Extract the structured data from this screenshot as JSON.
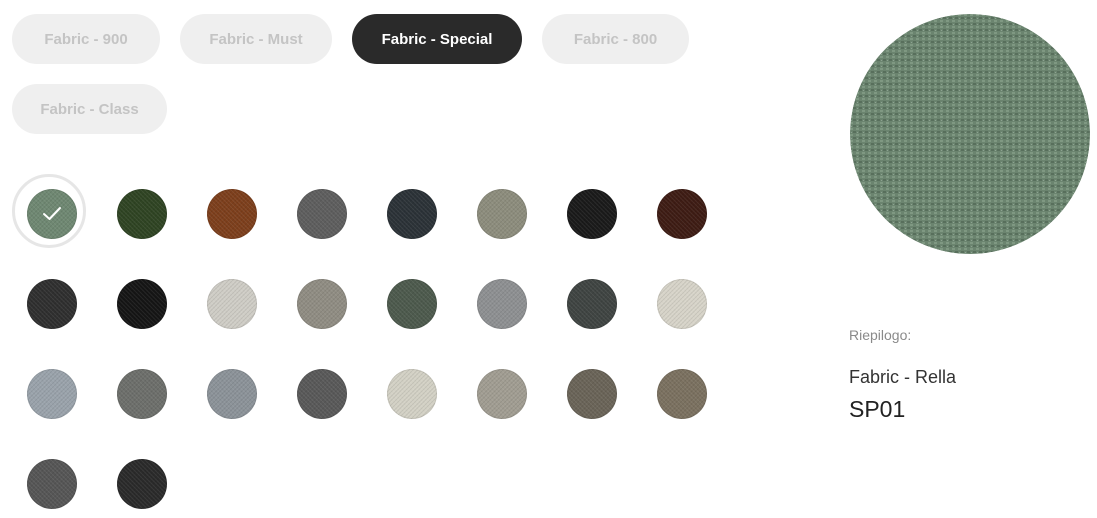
{
  "tabs": [
    {
      "label": "Fabric - 900",
      "active": false
    },
    {
      "label": "Fabric - Must",
      "active": false
    },
    {
      "label": "Fabric - Special",
      "active": true
    },
    {
      "label": "Fabric - 800",
      "active": false
    },
    {
      "label": "Fabric - Class",
      "active": false
    }
  ],
  "swatches": [
    {
      "color": "#6f8872",
      "selected": true
    },
    {
      "color": "#2f4423",
      "selected": false
    },
    {
      "color": "#7d3f1c",
      "selected": false
    },
    {
      "color": "#5e5e5e",
      "selected": false
    },
    {
      "color": "#2b3237",
      "selected": false
    },
    {
      "color": "#8d8d7d",
      "selected": false
    },
    {
      "color": "#1a1a1a",
      "selected": false
    },
    {
      "color": "#3e1c14",
      "selected": false
    },
    {
      "color": "#2f2f2f",
      "selected": false
    },
    {
      "color": "#151515",
      "selected": false
    },
    {
      "color": "#cfcdc6",
      "selected": false
    },
    {
      "color": "#908d83",
      "selected": false
    },
    {
      "color": "#4d5a4d",
      "selected": false
    },
    {
      "color": "#8e9092",
      "selected": false
    },
    {
      "color": "#3f4442",
      "selected": false
    },
    {
      "color": "#d7d4c9",
      "selected": false
    },
    {
      "color": "#9aa3ab",
      "selected": false
    },
    {
      "color": "#6d6f6b",
      "selected": false
    },
    {
      "color": "#8c9399",
      "selected": false
    },
    {
      "color": "#595959",
      "selected": false
    },
    {
      "color": "#d3d1c5",
      "selected": false
    },
    {
      "color": "#a19d92",
      "selected": false
    },
    {
      "color": "#6a6458",
      "selected": false
    },
    {
      "color": "#7b7160",
      "selected": false
    },
    {
      "color": "#565656",
      "selected": false
    },
    {
      "color": "#2a2a2a",
      "selected": false
    }
  ],
  "preview": {
    "color": "#6b846f"
  },
  "summary": {
    "label": "Riepilogo:",
    "fabric_name": "Fabric - Rella",
    "code": "SP01"
  }
}
